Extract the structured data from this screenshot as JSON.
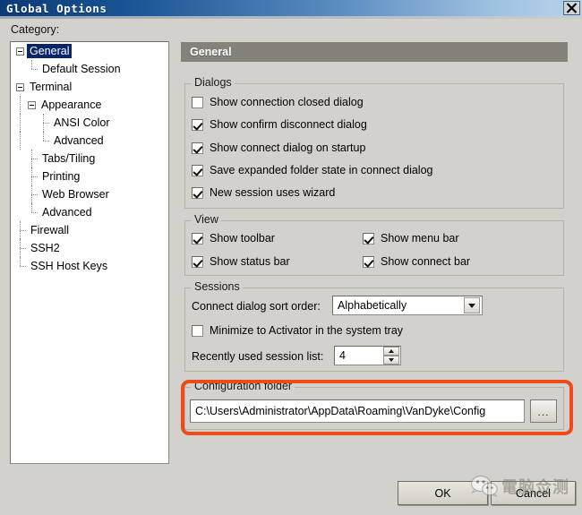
{
  "window": {
    "title": "Global Options",
    "close_icon": "close-icon"
  },
  "category": {
    "label": "Category:",
    "tree": [
      {
        "label": "General",
        "selected": true
      },
      {
        "label": "Default Session",
        "selected": false
      },
      {
        "label": "Terminal",
        "selected": false
      },
      {
        "label": "Appearance",
        "selected": false
      },
      {
        "label": "ANSI Color",
        "selected": false
      },
      {
        "label": "Advanced",
        "selected": false
      },
      {
        "label": "Tabs/Tiling",
        "selected": false
      },
      {
        "label": "Printing",
        "selected": false
      },
      {
        "label": "Web Browser",
        "selected": false
      },
      {
        "label": "Advanced",
        "selected": false
      },
      {
        "label": "Firewall",
        "selected": false
      },
      {
        "label": "SSH2",
        "selected": false
      },
      {
        "label": "SSH Host Keys",
        "selected": false
      }
    ]
  },
  "pane": {
    "header": "General",
    "dialogs": {
      "legend": "Dialogs",
      "items": [
        {
          "label": "Show connection closed dialog",
          "checked": false
        },
        {
          "label": "Show confirm disconnect dialog",
          "checked": true
        },
        {
          "label": "Show connect dialog on startup",
          "checked": true
        },
        {
          "label": "Save expanded folder state in connect dialog",
          "checked": true
        },
        {
          "label": "New session uses wizard",
          "checked": true
        }
      ]
    },
    "view": {
      "legend": "View",
      "items": [
        {
          "label": "Show toolbar",
          "checked": true
        },
        {
          "label": "Show menu bar",
          "checked": true
        },
        {
          "label": "Show status bar",
          "checked": true
        },
        {
          "label": "Show connect bar",
          "checked": true
        }
      ]
    },
    "sessions": {
      "legend": "Sessions",
      "sort_order_label": "Connect dialog sort order:",
      "sort_order_value": "Alphabetically",
      "minimize_label": "Minimize to Activator in the system tray",
      "minimize_checked": false,
      "recent_label": "Recently used session list:",
      "recent_value": "4"
    },
    "config_folder": {
      "legend": "Configuration folder",
      "path": "C:\\Users\\Administrator\\AppData\\Roaming\\VanDyke\\Config",
      "browse_label": "...",
      "highlight_color": "#ef4b1a"
    }
  },
  "footer": {
    "ok_label": "OK",
    "cancel_label": "Cancel"
  },
  "watermark": {
    "text": "電脑佥测",
    "logo": "wechat-icon"
  }
}
